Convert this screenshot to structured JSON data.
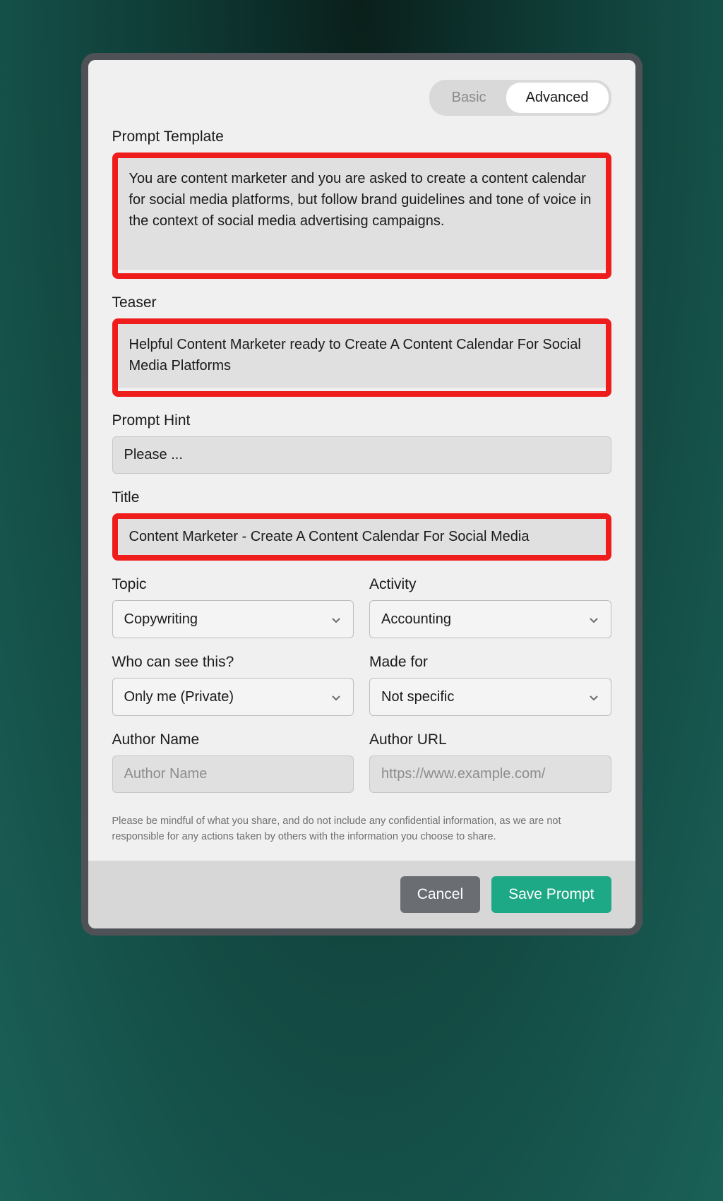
{
  "tabs": {
    "basic": "Basic",
    "advanced": "Advanced"
  },
  "fields": {
    "promptTemplate": {
      "label": "Prompt Template",
      "value": "You are content marketer and you are asked to create a content calendar for social media platforms, but follow brand guidelines and tone of voice in the context of social media advertising campaigns."
    },
    "teaser": {
      "label": "Teaser",
      "value": "Helpful Content Marketer ready to Create A Content Calendar For Social Media Platforms"
    },
    "promptHint": {
      "label": "Prompt Hint",
      "value": "Please ..."
    },
    "title": {
      "label": "Title",
      "value": "Content Marketer - Create A Content Calendar For Social Media"
    },
    "topic": {
      "label": "Topic",
      "value": "Copywriting"
    },
    "activity": {
      "label": "Activity",
      "value": "Accounting"
    },
    "visibility": {
      "label": "Who can see this?",
      "value": "Only me (Private)"
    },
    "madeFor": {
      "label": "Made for",
      "value": "Not specific"
    },
    "authorName": {
      "label": "Author Name",
      "placeholder": "Author Name",
      "value": ""
    },
    "authorUrl": {
      "label": "Author URL",
      "placeholder": "https://www.example.com/",
      "value": ""
    }
  },
  "disclaimer": "Please be mindful of what you share, and do not include any confidential information, as we are not responsible for any actions taken by others with the information you choose to share.",
  "buttons": {
    "cancel": "Cancel",
    "save": "Save Prompt"
  }
}
